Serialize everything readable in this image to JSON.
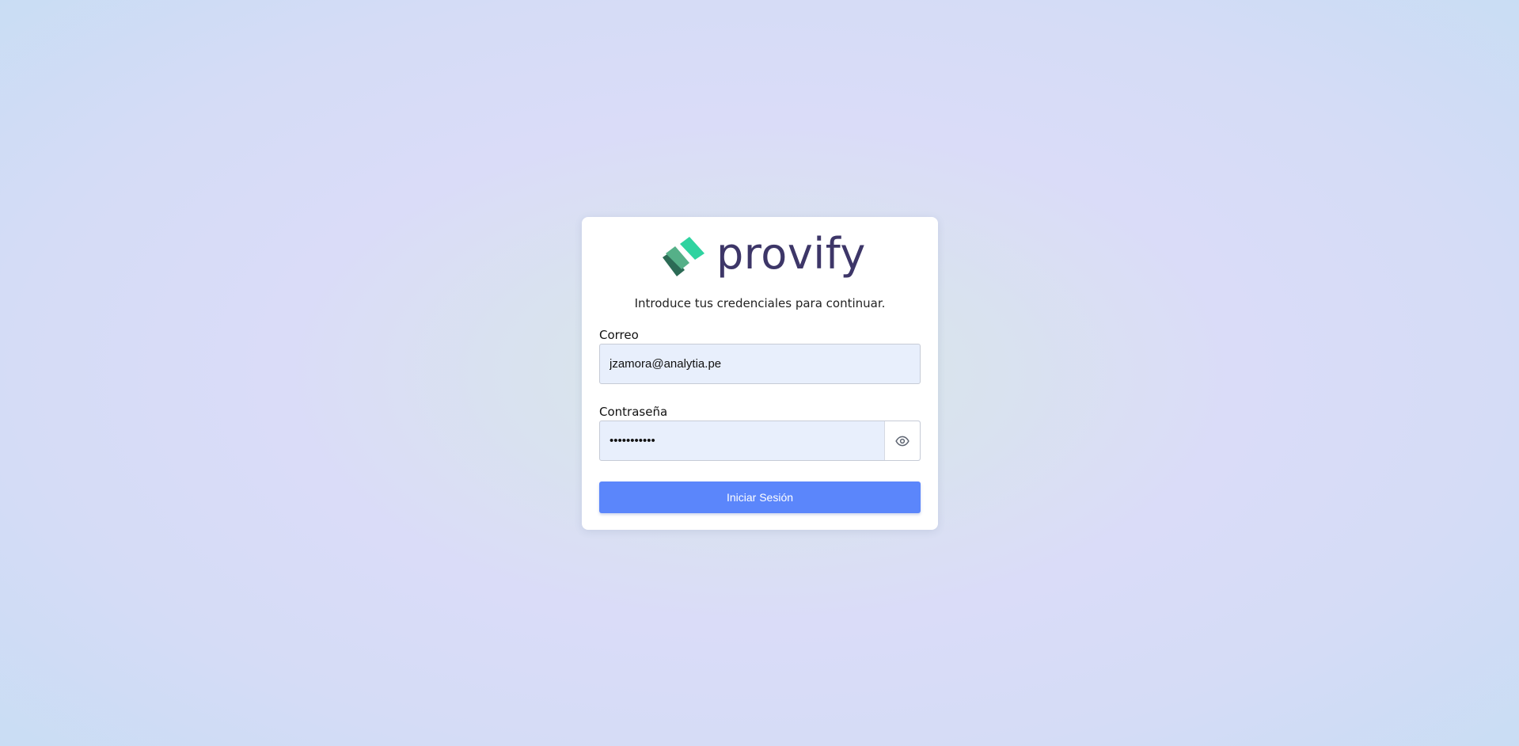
{
  "brand": {
    "name": "provify",
    "logo_icon": "provify-logo-icon",
    "text_color": "#3d3668",
    "accent_colors": [
      "#2fd3a0",
      "#55b088",
      "#2c6b55"
    ]
  },
  "login": {
    "subtitle": "Introduce tus credenciales para continuar.",
    "email": {
      "label": "Correo",
      "value": "jzamora@analytia.pe"
    },
    "password": {
      "label": "Contraseña",
      "value": "•••••••••••",
      "toggle_icon": "eye-icon"
    },
    "submit_label": "Iniciar Sesión",
    "submit_color": "#5b86fb"
  }
}
